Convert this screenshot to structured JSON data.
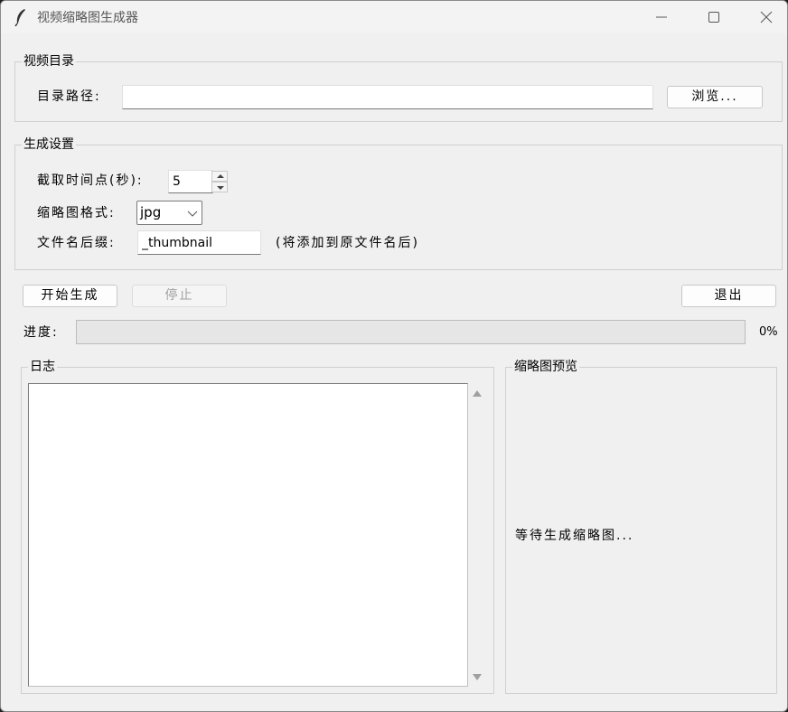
{
  "window": {
    "title": "视频缩略图生成器"
  },
  "video_dir": {
    "legend": "视频目录",
    "path_label": "目录路径:",
    "path_value": "",
    "browse_label": "浏览..."
  },
  "settings": {
    "legend": "生成设置",
    "time_label": "截取时间点(秒):",
    "time_value": "5",
    "format_label": "缩略图格式:",
    "format_value": "jpg",
    "suffix_label": "文件名后缀:",
    "suffix_value": "_thumbnail",
    "suffix_hint": "(将添加到原文件名后)"
  },
  "actions": {
    "start_label": "开始生成",
    "stop_label": "停止",
    "exit_label": "退出"
  },
  "progress": {
    "label": "进度:",
    "percent_text": "0%",
    "value": 0
  },
  "log": {
    "legend": "日志",
    "content": ""
  },
  "preview": {
    "legend": "缩略图预览",
    "placeholder": "等待生成缩略图..."
  },
  "icons": {
    "app": "feather-icon",
    "minimize": "minimize-icon",
    "maximize": "maximize-icon",
    "close": "close-icon"
  },
  "colors": {
    "window_bg": "#f0f0f0",
    "progress_fill": "#06b025"
  }
}
